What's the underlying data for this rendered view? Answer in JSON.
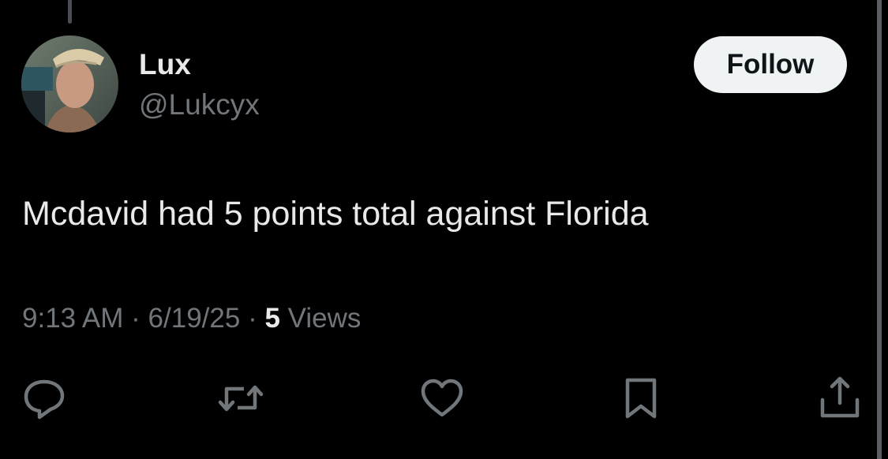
{
  "tweet": {
    "author": {
      "display_name": "Lux",
      "handle": "@Lukcyx"
    },
    "follow_label": "Follow",
    "text": "Mcdavid had 5 points total against Florida",
    "time": "9:13 AM",
    "date": "6/19/25",
    "separator": "·",
    "views_count": "5",
    "views_label": "Views"
  },
  "actions": [
    {
      "name": "reply",
      "icon": "reply-icon"
    },
    {
      "name": "repost",
      "icon": "repost-icon"
    },
    {
      "name": "like",
      "icon": "heart-icon"
    },
    {
      "name": "bookmark",
      "icon": "bookmark-icon"
    },
    {
      "name": "share",
      "icon": "share-icon"
    }
  ],
  "colors": {
    "background": "#000000",
    "primary_text": "#e7e9ea",
    "secondary_text": "#71767b",
    "follow_button_bg": "#eff3f4",
    "follow_button_text": "#0f1419"
  }
}
